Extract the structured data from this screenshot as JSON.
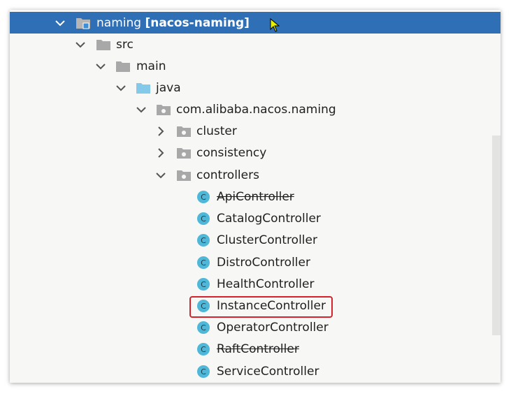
{
  "tree": {
    "root": {
      "name": "naming",
      "module": "[nacos-naming]"
    },
    "src": "src",
    "main": "main",
    "java": "java",
    "package": "com.alibaba.nacos.naming",
    "cluster": "cluster",
    "consistency": "consistency",
    "controllers": "controllers",
    "classes": [
      {
        "name": "ApiController",
        "deprecated": true
      },
      {
        "name": "CatalogController",
        "deprecated": false
      },
      {
        "name": "ClusterController",
        "deprecated": false
      },
      {
        "name": "DistroController",
        "deprecated": false
      },
      {
        "name": "HealthController",
        "deprecated": false
      },
      {
        "name": "InstanceController",
        "deprecated": false,
        "highlighted": true
      },
      {
        "name": "OperatorController",
        "deprecated": false
      },
      {
        "name": "RaftController",
        "deprecated": true
      },
      {
        "name": "ServiceController",
        "deprecated": false
      }
    ]
  },
  "colors": {
    "selection": "#2f6fb6",
    "folder_gray": "#a8a8a8",
    "folder_blue": "#84c8ea",
    "class_icon": "#4fb7d8",
    "highlight_border": "#d6222a"
  },
  "icons": {
    "chevron_expanded": "chevron-down-icon",
    "chevron_collapsed": "chevron-right-icon",
    "module": "module-folder-icon",
    "folder": "folder-icon",
    "source_root": "source-root-folder-icon",
    "package": "package-icon",
    "class": "class-icon"
  }
}
